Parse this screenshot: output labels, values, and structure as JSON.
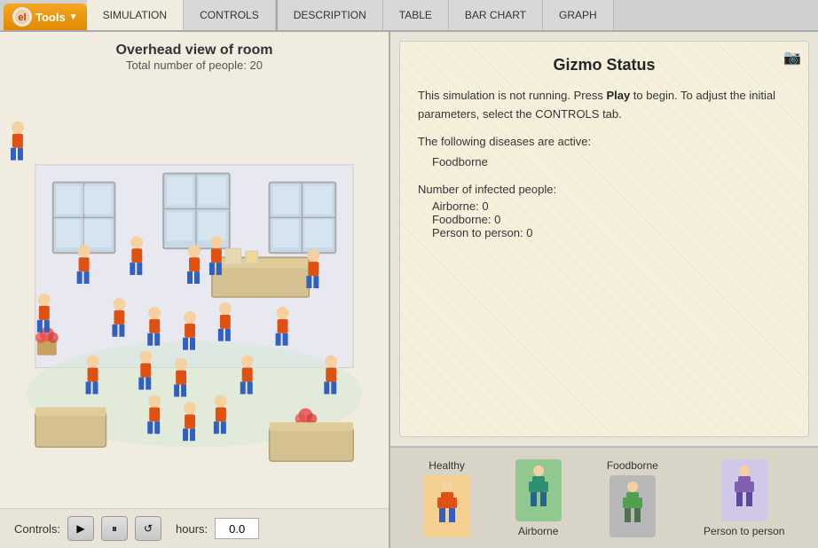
{
  "nav": {
    "tools_label": "Tools",
    "tabs": [
      {
        "id": "simulation",
        "label": "SIMULATION",
        "active": true
      },
      {
        "id": "controls",
        "label": "CONTROLS"
      },
      {
        "id": "description",
        "label": "DESCRIPTION"
      },
      {
        "id": "table",
        "label": "TABLE"
      },
      {
        "id": "bar_chart",
        "label": "BAR CHART"
      },
      {
        "id": "graph",
        "label": "GRAPH"
      }
    ]
  },
  "simulation": {
    "title": "Overhead view of room",
    "subtitle": "Total number of people: 20",
    "controls_label": "Controls:",
    "hours_label": "hours:",
    "hours_value": "0.0"
  },
  "status": {
    "title": "Gizmo Status",
    "description_line1": "This simulation is not running. Press",
    "play_label": "Play",
    "description_line2": "to begin. To adjust the initial parameters, select the CONTROLS tab.",
    "diseases_intro": "The following diseases are active:",
    "active_diseases": [
      "Foodborne"
    ],
    "infected_title": "Number of infected people:",
    "infected_items": [
      {
        "label": "Airborne: 0"
      },
      {
        "label": "Foodborne: 0"
      },
      {
        "label": "Person to person: 0"
      }
    ]
  },
  "legend": {
    "items": [
      {
        "id": "healthy",
        "label": "Healthy",
        "color_class": "legend-healthy",
        "figure_color": "#c0392b"
      },
      {
        "id": "airborne",
        "label": "Airborne",
        "color_class": "legend-airborne",
        "figure_color": "#2e7d32"
      },
      {
        "id": "foodborne",
        "label": "Foodborne",
        "color_class": "legend-foodborne",
        "figure_color": "#555"
      },
      {
        "id": "person",
        "label": "Person to person",
        "color_class": "legend-person",
        "figure_color": "#6a1b9a"
      }
    ]
  }
}
